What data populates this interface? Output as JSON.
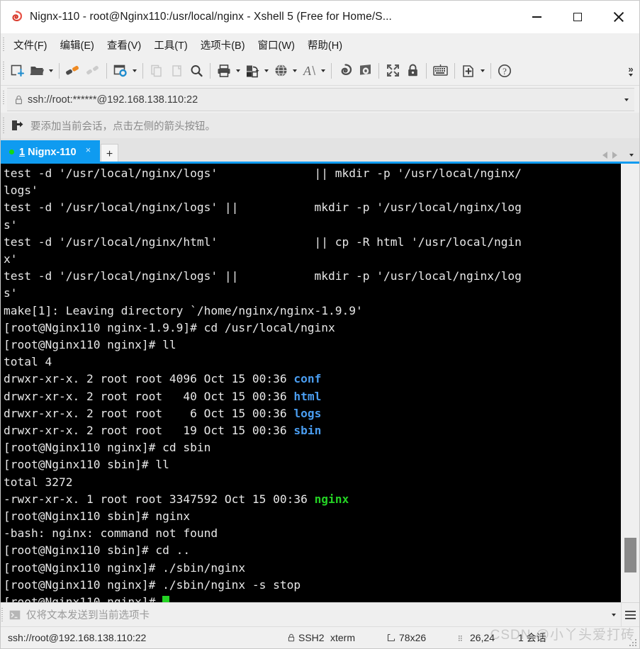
{
  "window": {
    "title": "Nignx-110 - root@Nginx110:/usr/local/nginx - Xshell 5 (Free for Home/S...",
    "app_icon": "xshell-shell-icon",
    "minimize_label": "–",
    "maximize_label": "❑",
    "close_label": "✕",
    "accent_color": "#0f9bf0",
    "titlebar_bg": "#ffffff",
    "chrome_bg": "#f0f0f0"
  },
  "menubar": {
    "items": [
      {
        "label": "文件(F)",
        "name": "menu-file"
      },
      {
        "label": "编辑(E)",
        "name": "menu-edit"
      },
      {
        "label": "查看(V)",
        "name": "menu-view"
      },
      {
        "label": "工具(T)",
        "name": "menu-tools"
      },
      {
        "label": "选项卡(B)",
        "name": "menu-tabs"
      },
      {
        "label": "窗口(W)",
        "name": "menu-window"
      },
      {
        "label": "帮助(H)",
        "name": "menu-help"
      }
    ]
  },
  "toolbar": {
    "buttons": [
      {
        "icon": "new-session-icon",
        "caret": false
      },
      {
        "icon": "open-folder-icon",
        "caret": true
      },
      {
        "sep": true
      },
      {
        "icon": "connect-icon",
        "caret": false
      },
      {
        "icon": "disconnect-icon",
        "caret": false,
        "disabled": true
      },
      {
        "sep": true
      },
      {
        "icon": "session-properties-icon",
        "caret": true
      },
      {
        "sep": true
      },
      {
        "icon": "copy-icon",
        "caret": false,
        "disabled": true
      },
      {
        "icon": "paste-icon",
        "caret": false,
        "disabled": true
      },
      {
        "icon": "find-icon",
        "caret": false
      },
      {
        "sep": true
      },
      {
        "icon": "print-icon",
        "caret": true
      },
      {
        "icon": "file-transfer-icon",
        "caret": true
      },
      {
        "icon": "globe-icon",
        "caret": true
      },
      {
        "icon": "font-icon",
        "caret": true
      },
      {
        "sep": true
      },
      {
        "icon": "xshell-icon",
        "caret": false
      },
      {
        "icon": "xftp-icon",
        "caret": false
      },
      {
        "sep": true
      },
      {
        "icon": "fullscreen-icon",
        "caret": false
      },
      {
        "icon": "lock-icon",
        "caret": false
      },
      {
        "sep": true
      },
      {
        "icon": "keyboard-icon",
        "caret": false
      },
      {
        "sep": true
      },
      {
        "icon": "add-to-favorites-icon",
        "caret": true
      },
      {
        "sep": true
      },
      {
        "icon": "help-icon",
        "caret": false
      }
    ],
    "overflow_label": "»"
  },
  "address_bar": {
    "icon": "lock-icon",
    "value": "ssh://root:******@192.168.138.110:22",
    "placeholder": "ssh://",
    "dropdown_icon": "chevron-down-icon"
  },
  "info_bar": {
    "icon": "add-session-arrow-icon",
    "text": "要添加当前会话，点击左侧的箭头按钮。"
  },
  "tabs": {
    "items": [
      {
        "index": "1",
        "title": "Nignx-110",
        "status_dot_color": "#12d912",
        "active": true,
        "close_label": "×"
      }
    ],
    "add_label": "+",
    "nav_prev_icon": "chevron-left-icon",
    "nav_next_icon": "chevron-right-icon",
    "nav_menu_icon": "chevron-down-icon"
  },
  "terminal": {
    "colors": {
      "bg": "#000000",
      "fg": "#e8e8e8",
      "dir": "#4a9df0",
      "exec": "#24d324"
    },
    "lines": [
      {
        "segs": [
          {
            "t": "test -d '/usr/local/nginx/logs'              || mkdir -p '/usr/local/nginx/"
          }
        ]
      },
      {
        "segs": [
          {
            "t": "logs'"
          }
        ]
      },
      {
        "segs": [
          {
            "t": "test -d '/usr/local/nginx/logs' ||           mkdir -p '/usr/local/nginx/log"
          }
        ]
      },
      {
        "segs": [
          {
            "t": "s'"
          }
        ]
      },
      {
        "segs": [
          {
            "t": "test -d '/usr/local/nginx/html'              || cp -R html '/usr/local/ngin"
          }
        ]
      },
      {
        "segs": [
          {
            "t": "x'"
          }
        ]
      },
      {
        "segs": [
          {
            "t": "test -d '/usr/local/nginx/logs' ||           mkdir -p '/usr/local/nginx/log"
          }
        ]
      },
      {
        "segs": [
          {
            "t": "s'"
          }
        ]
      },
      {
        "segs": [
          {
            "t": "make[1]: Leaving directory `/home/nginx/nginx-1.9.9'"
          }
        ]
      },
      {
        "segs": [
          {
            "t": "[root@Nginx110 nginx-1.9.9]# cd /usr/local/nginx"
          }
        ]
      },
      {
        "segs": [
          {
            "t": "[root@Nginx110 nginx]# ll"
          }
        ]
      },
      {
        "segs": [
          {
            "t": "total 4"
          }
        ]
      },
      {
        "segs": [
          {
            "t": "drwxr-xr-x. 2 root root 4096 Oct 15 00:36 "
          },
          {
            "t": "conf",
            "c": "c-blue"
          }
        ]
      },
      {
        "segs": [
          {
            "t": "drwxr-xr-x. 2 root root   40 Oct 15 00:36 "
          },
          {
            "t": "html",
            "c": "c-blue"
          }
        ]
      },
      {
        "segs": [
          {
            "t": "drwxr-xr-x. 2 root root    6 Oct 15 00:36 "
          },
          {
            "t": "logs",
            "c": "c-blue"
          }
        ]
      },
      {
        "segs": [
          {
            "t": "drwxr-xr-x. 2 root root   19 Oct 15 00:36 "
          },
          {
            "t": "sbin",
            "c": "c-blue"
          }
        ]
      },
      {
        "segs": [
          {
            "t": "[root@Nginx110 nginx]# cd sbin"
          }
        ]
      },
      {
        "segs": [
          {
            "t": "[root@Nginx110 sbin]# ll"
          }
        ]
      },
      {
        "segs": [
          {
            "t": "total 3272"
          }
        ]
      },
      {
        "segs": [
          {
            "t": "-rwxr-xr-x. 1 root root 3347592 Oct 15 00:36 "
          },
          {
            "t": "nginx",
            "c": "c-green"
          }
        ]
      },
      {
        "segs": [
          {
            "t": "[root@Nginx110 sbin]# nginx"
          }
        ]
      },
      {
        "segs": [
          {
            "t": "-bash: nginx: command not found"
          }
        ]
      },
      {
        "segs": [
          {
            "t": "[root@Nginx110 sbin]# cd .."
          }
        ]
      },
      {
        "segs": [
          {
            "t": "[root@Nginx110 nginx]# ./sbin/nginx"
          }
        ]
      },
      {
        "segs": [
          {
            "t": "[root@Nginx110 nginx]# ./sbin/nginx -s stop"
          }
        ]
      },
      {
        "segs": [
          {
            "t": "[root@Nginx110 nginx]# "
          },
          {
            "cursor": true
          }
        ]
      }
    ]
  },
  "quick_command_bar": {
    "icon": "terminal-prompt-icon",
    "placeholder": "仅将文本发送到当前选项卡",
    "value": "",
    "dropdown_icon": "chevron-down-icon",
    "menu_icon": "hamburger-menu-icon"
  },
  "status_bar": {
    "url": "ssh://root@192.168.138.110:22",
    "protocol_icon": "lock-icon",
    "protocol": "SSH2",
    "emulation": "xterm",
    "size_icon": "resize-icon",
    "size": "78x26",
    "cursor_icon": "cursor-position-icon",
    "cursor_position": "26,24",
    "sessions": "1 会话",
    "resize_grip_icon": "resize-grip-icon"
  },
  "watermark": {
    "text": "CSDN @小丫头爱打砖"
  }
}
